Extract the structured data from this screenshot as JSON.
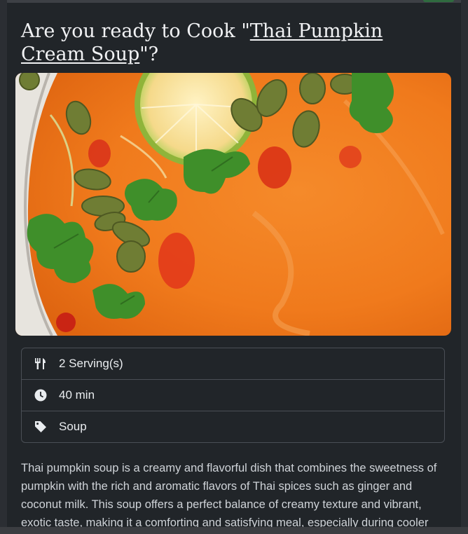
{
  "page": {
    "title_prefix": "Are you ready to Cook \"",
    "recipe_name": "Thai Pumpkin Cream Soup",
    "title_suffix": "\"?"
  },
  "hero_image": {
    "alt": "Thai Pumpkin Cream Soup"
  },
  "info": {
    "servings": {
      "icon": "utensils-icon",
      "label": "2 Serving(s)"
    },
    "time": {
      "icon": "clock-icon",
      "label": "40 min"
    },
    "category": {
      "icon": "tag-icon",
      "label": "Soup"
    }
  },
  "description": "Thai pumpkin soup is a creamy and flavorful dish that combines the sweetness of pumpkin with the rich and aromatic flavors of Thai spices such as ginger and coconut milk. This soup offers a perfect balance of creamy texture and vibrant, exotic taste, making it a comforting and satisfying meal, especially during cooler",
  "colors": {
    "background": "#212529",
    "soup": "#f07a1c",
    "text": "#f1f2f4",
    "border": "#4a4f56"
  }
}
